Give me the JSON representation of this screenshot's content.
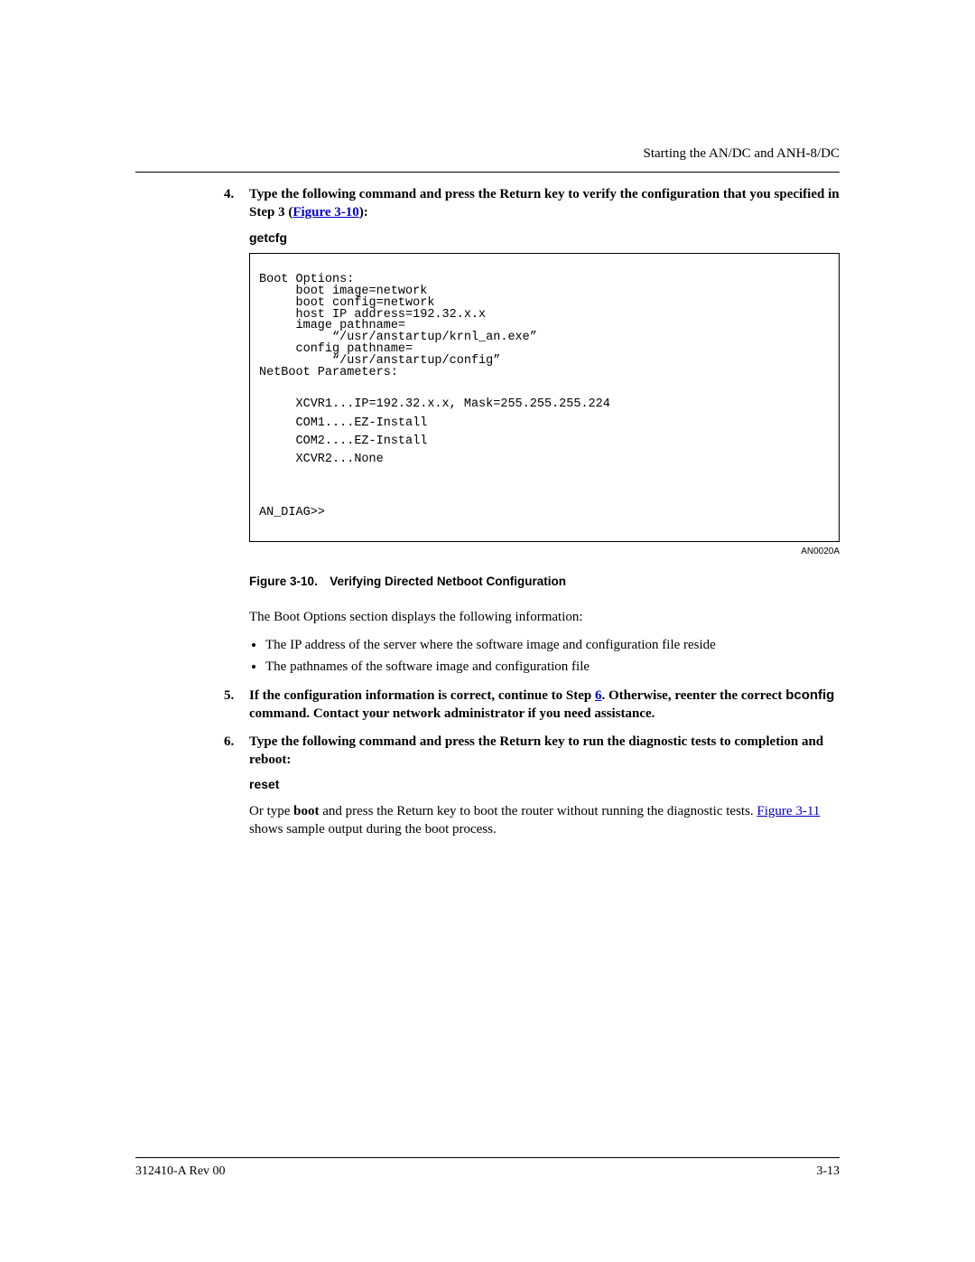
{
  "header": {
    "running_title": "Starting the AN/DC and ANH-8/DC"
  },
  "steps": {
    "s4": {
      "num": "4.",
      "text_before_link": "Type the following command and press the Return key to verify the configuration that you specified in Step 3 ",
      "link_prefix": "(",
      "link_text": "Figure 3-10",
      "link_suffix": "):",
      "cmd": "getcfg"
    },
    "s5": {
      "num": "5.",
      "text_before_link": "If the configuration information is correct, continue to Step ",
      "link_text": "6",
      "text_after_link": ". Otherwise, reenter the correct ",
      "cmd_word": "bconfig",
      "text_tail": " command. Contact your network administrator if you need assistance."
    },
    "s6": {
      "num": "6.",
      "text": "Type the following command and press the Return key to run the diagnostic tests to completion and reboot:",
      "cmd": "reset"
    }
  },
  "terminal": {
    "l1": "Boot Options:",
    "l2": "     boot image=network",
    "l3": "     boot config=network",
    "l4": "     host IP address=192.32.x.x",
    "l5": "     image pathname=",
    "l6": "          “/usr/anstartup/krnl_an.exe”",
    "l7": "     config pathname=",
    "l8": "          “/usr/anstartup/config”",
    "l9": "NetBoot Parameters:",
    "l10": "     XCVR1...IP=192.32.x.x, Mask=255.255.255.224",
    "l11": "     COM1....EZ-Install",
    "l12": "     COM2....EZ-Install",
    "l13": "     XCVR2...None",
    "l14": "AN_DIAG>>"
  },
  "figure": {
    "small_id": "AN0020A",
    "caption": "Figure 3-10. Verifying Directed Netboot Configuration"
  },
  "body": {
    "p1": "The Boot Options section displays the following information:",
    "b1": "The IP address of the server where the software image and configuration file reside",
    "b2": "The pathnames of the software image and configuration file",
    "p2_a": "Or type ",
    "p2_bold": "boot",
    "p2_b": " and press the Return key to boot the router without running the diagnostic tests. ",
    "p2_link": "Figure 3-11",
    "p2_c": " shows sample output during the boot process."
  },
  "footer": {
    "left": "312410-A Rev 00",
    "right": "3-13"
  }
}
